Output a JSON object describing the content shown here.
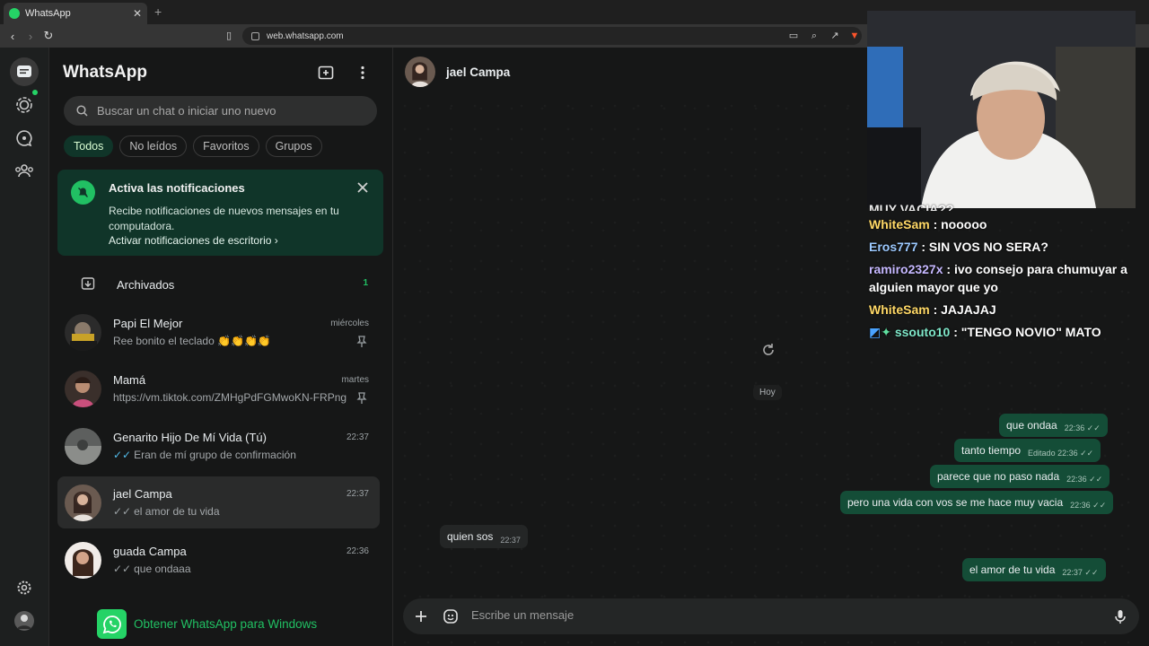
{
  "browser": {
    "tab_title": "WhatsApp",
    "url": "web.whatsapp.com"
  },
  "sidebar": {
    "title": "WhatsApp",
    "search_placeholder": "Buscar un chat o iniciar uno nuevo",
    "filters": [
      "Todos",
      "No leídos",
      "Favoritos",
      "Grupos"
    ],
    "notification": {
      "title": "Activa las notificaciones",
      "body": "Recibe notificaciones de nuevos mensajes en tu computadora.",
      "link": "Activar notificaciones de escritorio"
    },
    "archived": {
      "label": "Archivados",
      "count": "1"
    },
    "chats": [
      {
        "name": "Papi El Mejor",
        "time": "miércoles",
        "preview": "Ree bonito el teclado 👏👏👏👏",
        "pinned": true,
        "ticks": false
      },
      {
        "name": "Mamá",
        "time": "martes",
        "preview": "https://vm.tiktok.com/ZMHgPdFGMwoKN-FRPng/",
        "pinned": true,
        "ticks": false
      },
      {
        "name": "Genarito Hijo De Mí Vida (Tú)",
        "time": "22:37",
        "preview": "Eran de mí grupo de confirmación",
        "pinned": false,
        "ticks": true
      },
      {
        "name": "jael Campa",
        "time": "22:37",
        "preview": "el amor de tu vida",
        "pinned": false,
        "ticks": true
      },
      {
        "name": "guada Campa",
        "time": "22:36",
        "preview": "que ondaaa",
        "pinned": false,
        "ticks": true
      }
    ],
    "get_app": "Obtener WhatsApp para Windows"
  },
  "conversation": {
    "contact_name": "jael Campa",
    "day_label": "Hoy",
    "messages": [
      {
        "dir": "out",
        "text": "que ondaa",
        "meta": "22:36 ✓✓"
      },
      {
        "dir": "out",
        "text": "tanto tiempo",
        "meta": "Editado 22:36 ✓✓"
      },
      {
        "dir": "out",
        "text": "parece que no paso nada",
        "meta": "22:36 ✓✓"
      },
      {
        "dir": "out",
        "text": "pero una vida con vos se me hace muy vacia",
        "meta": "22:36 ✓✓"
      },
      {
        "dir": "in",
        "text": "quien sos",
        "meta": "22:37"
      },
      {
        "dir": "out",
        "text": "el amor de tu vida",
        "meta": "22:37 ✓✓"
      }
    ],
    "composer_placeholder": "Escribe un mensaje"
  },
  "stream_chat": [
    {
      "user": "WhiteSam",
      "text": " : nooooo"
    },
    {
      "user": "Eros777",
      "text": " : SIN VOS NO SERA?"
    },
    {
      "user": "ramiro2327x",
      "text": " : ivo consejo para chumuyar a alguien mayor que yo"
    },
    {
      "user": "WhiteSam",
      "text": " : JAJAJAJ"
    },
    {
      "user": "ssouto10",
      "text": " : \"TENGO NOVIO\" MATO"
    }
  ],
  "stream_chat_partial": "MUY VACIA??",
  "colors": {
    "accent": "#21c063",
    "outgoing_bubble": "#144d37",
    "incoming_bubble": "#242626",
    "panel": "#161717"
  }
}
